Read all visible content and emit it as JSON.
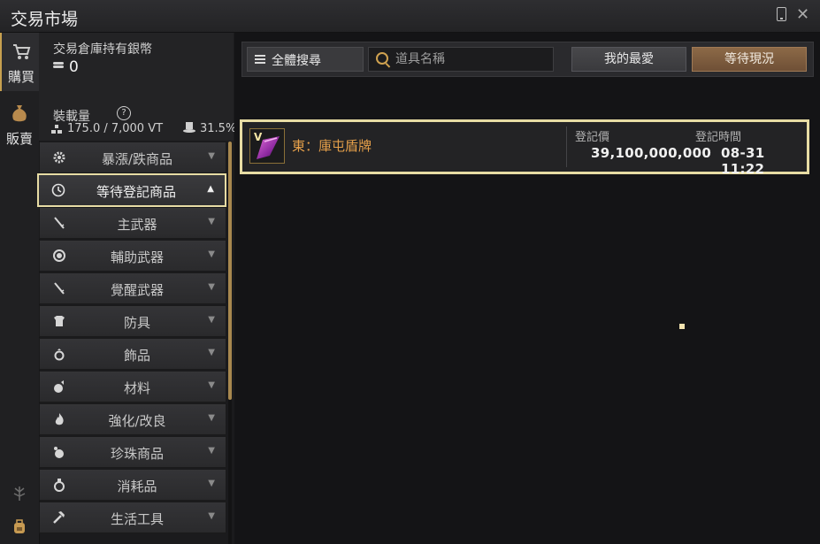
{
  "window": {
    "title": "交易市場"
  },
  "nav": {
    "tabs": [
      {
        "label": "購買",
        "icon": "cart-icon",
        "active": true
      },
      {
        "label": "販賣",
        "icon": "money-bag-icon",
        "active": false
      }
    ]
  },
  "info": {
    "silver_label": "交易倉庫持有銀幣",
    "silver_value": "0",
    "weight_label": "裝載量",
    "weight_value": "175.0 / 7,000 VT",
    "weight_percent": "31.5%"
  },
  "categories": [
    {
      "label": "暴漲/跌商品",
      "icon": "gear-icon"
    },
    {
      "label": "等待登記商品",
      "icon": "clock-icon",
      "selected": true
    },
    {
      "label": "主武器",
      "icon": "sword-icon"
    },
    {
      "label": "輔助武器",
      "icon": "orb-icon"
    },
    {
      "label": "覺醒武器",
      "icon": "sword-icon"
    },
    {
      "label": "防具",
      "icon": "armor-icon"
    },
    {
      "label": "飾品",
      "icon": "ring-icon"
    },
    {
      "label": "材料",
      "icon": "material-icon"
    },
    {
      "label": "強化/改良",
      "icon": "flame-icon"
    },
    {
      "label": "珍珠商品",
      "icon": "pearl-icon"
    },
    {
      "label": "消耗品",
      "icon": "potion-icon"
    },
    {
      "label": "生活工具",
      "icon": "hammer-icon"
    }
  ],
  "search": {
    "all_label": "全體搜尋",
    "placeholder": "道具名稱",
    "value": "",
    "favorites_label": "我的最愛",
    "waiting_label": "等待現況"
  },
  "listing": {
    "item_name": "東：庫屯盾牌",
    "enhance_badge": "V",
    "price_label": "登記價",
    "price_value": "39,100,000,000",
    "time_label": "登記時間",
    "time_value": "08-31 11:22"
  },
  "colors": {
    "accent": "#e7dca4",
    "item_name": "#e6a04a",
    "waiting_button": "#7d5b3e"
  }
}
